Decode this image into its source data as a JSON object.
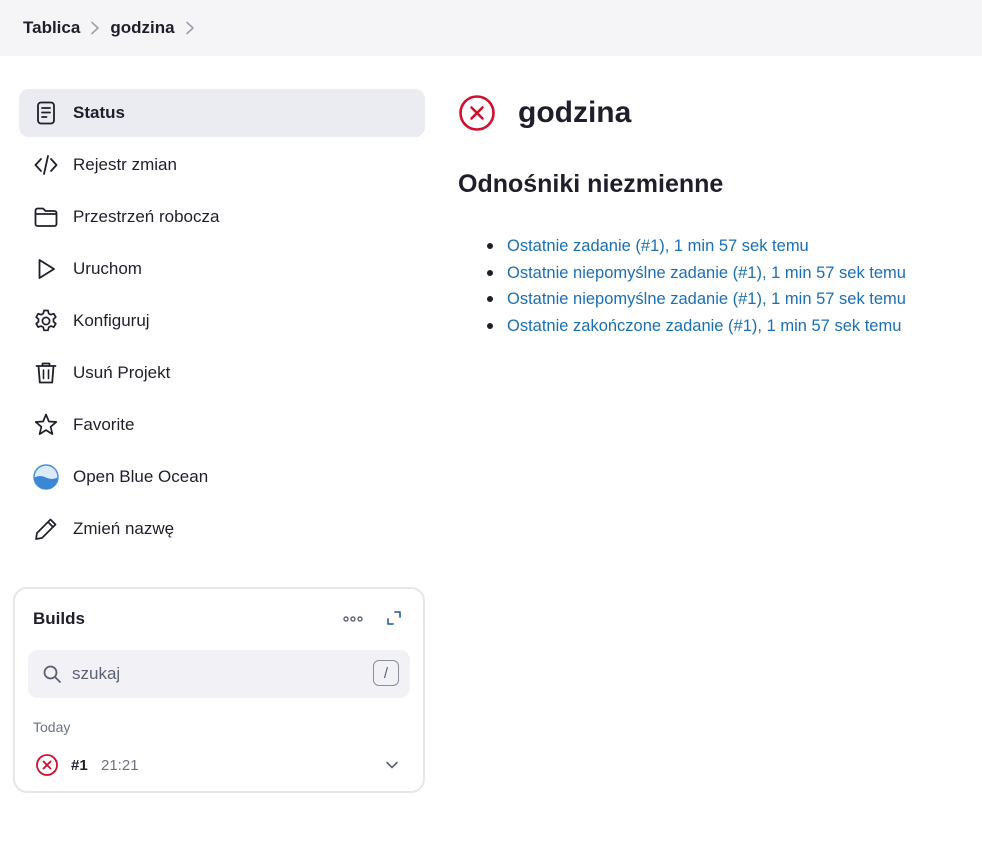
{
  "breadcrumb": {
    "items": [
      "Tablica",
      "godzina"
    ]
  },
  "sidebar": {
    "items": [
      {
        "label": "Status",
        "icon": "document-icon",
        "active": true
      },
      {
        "label": "Rejestr zmian",
        "icon": "code-icon"
      },
      {
        "label": "Przestrzeń robocza",
        "icon": "folder-icon"
      },
      {
        "label": "Uruchom",
        "icon": "play-icon"
      },
      {
        "label": "Konfiguruj",
        "icon": "gear-icon"
      },
      {
        "label": "Usuń Projekt",
        "icon": "trash-icon"
      },
      {
        "label": "Favorite",
        "icon": "star-icon"
      },
      {
        "label": "Open Blue Ocean",
        "icon": "blue-ocean-icon"
      },
      {
        "label": "Zmień nazwę",
        "icon": "pencil-icon"
      }
    ]
  },
  "builds": {
    "title": "Builds",
    "search": {
      "placeholder": "szukaj",
      "value": "",
      "shortcut": "/"
    },
    "group_label": "Today",
    "rows": [
      {
        "number": "#1",
        "time": "21:21",
        "status": "failed"
      }
    ]
  },
  "job": {
    "title": "godzina",
    "status": "failed"
  },
  "permalinks": {
    "title": "Odnośniki niezmienne",
    "links": [
      "Ostatnie zadanie (#1), 1 min 57 sek temu",
      "Ostatnie niepomyślne zadanie (#1), 1 min 57 sek temu",
      "Ostatnie niepomyślne zadanie (#1), 1 min 57 sek temu",
      "Ostatnie zakończone zadanie (#1), 1 min 57 sek temu"
    ]
  },
  "colors": {
    "failure_red": "#d0102d",
    "link_blue": "#1a6fb4",
    "active_bg": "#ebebf2",
    "header_bg": "#f5f5f8"
  }
}
